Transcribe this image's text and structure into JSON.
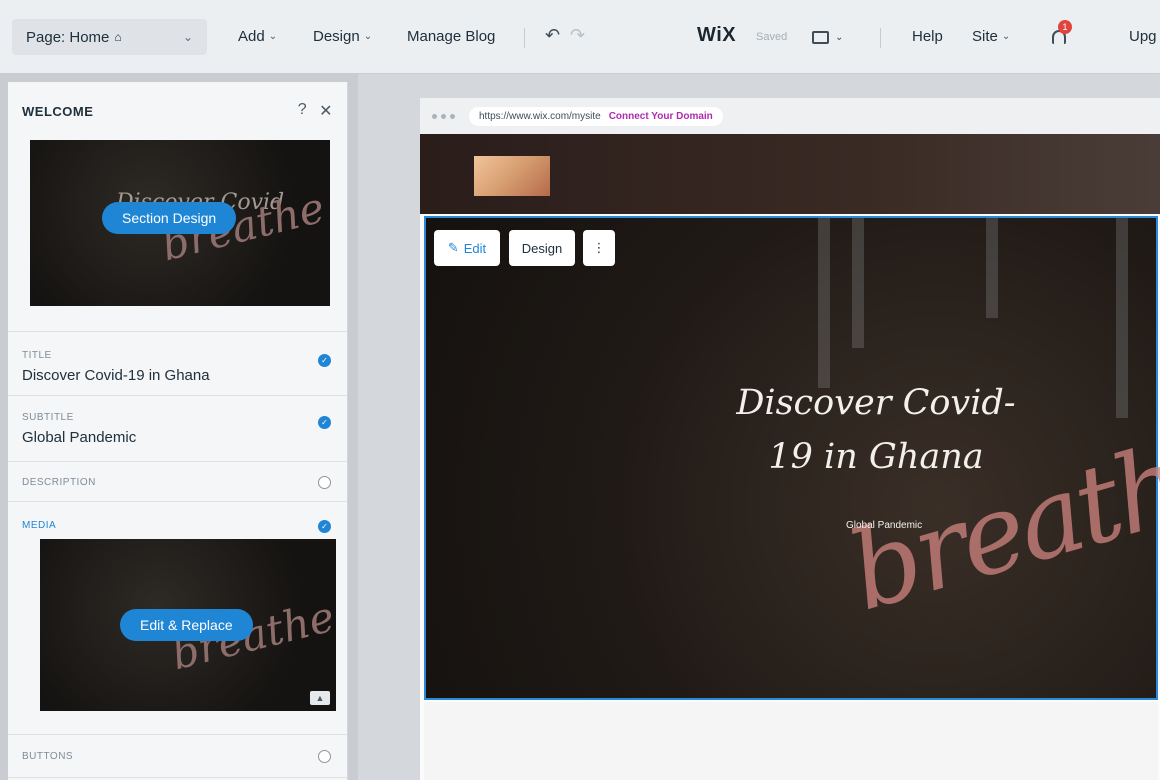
{
  "topbar": {
    "page_selector": "Page: Home",
    "menus": [
      "Add",
      "Design",
      "Manage Blog"
    ],
    "logo": "WiX",
    "saved": "Saved",
    "help": "Help",
    "site": "Site",
    "upgrade": "Upg",
    "notification_count": "1"
  },
  "panel": {
    "title": "WELCOME",
    "help": "?",
    "section_design_button": "Section Design",
    "fields": [
      {
        "label": "TITLE",
        "value": "Discover Covid-19 in Ghana",
        "checked": true
      },
      {
        "label": "SUBTITLE",
        "value": "Global Pandemic",
        "checked": true
      },
      {
        "label": "DESCRIPTION",
        "value": "",
        "checked": false
      },
      {
        "label": "MEDIA",
        "value": "",
        "checked": true
      },
      {
        "label": "BUTTONS",
        "value": "",
        "checked": false
      }
    ],
    "edit_replace_button": "Edit & Replace"
  },
  "browser": {
    "url": "https://www.wix.com/mysite",
    "connect_domain": "Connect Your Domain"
  },
  "hero": {
    "edit_button": "Edit",
    "design_button": "Design",
    "more_button": "⋮",
    "title_line1": "Discover Covid-",
    "title_line2": "19 in Ghana",
    "subtitle": "Global Pandemic",
    "script_text": "breathe"
  },
  "colors": {
    "accent": "#1f86d6",
    "selection": "#2b8ad8",
    "domain_link": "#b02ab0"
  }
}
